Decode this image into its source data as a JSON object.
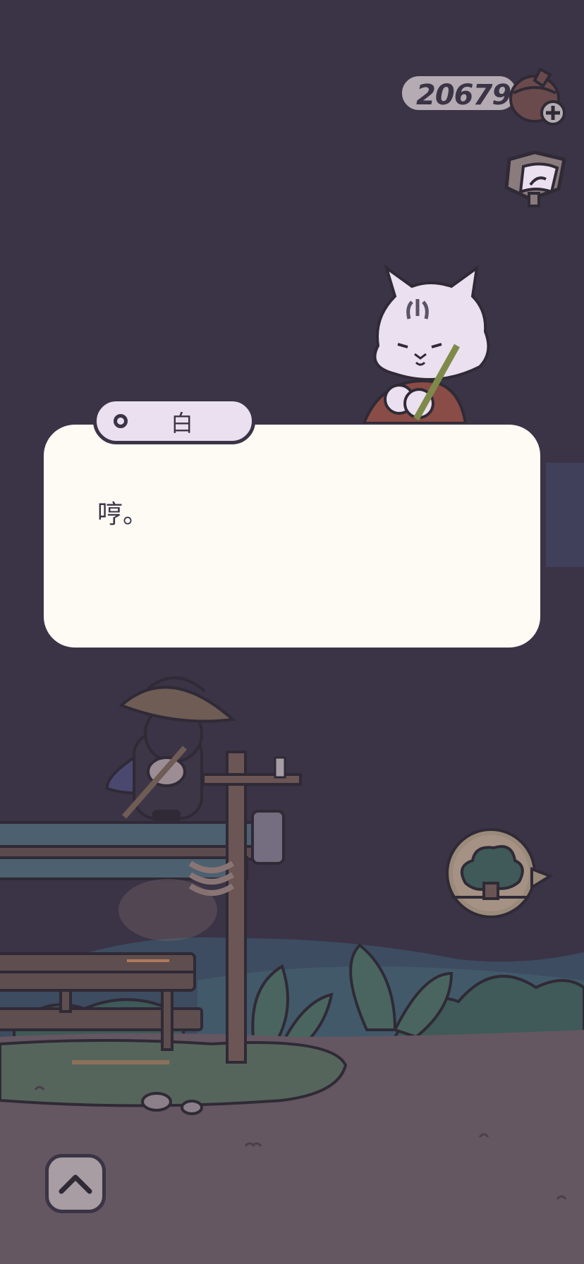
{
  "currency": {
    "amount": "20679",
    "icon": "acorn-icon",
    "add_icon": "plus-icon"
  },
  "journal": {
    "icon": "journal-icon"
  },
  "dialogue": {
    "speaker": "白",
    "text": "哼。"
  },
  "destination": {
    "icon": "tree-icon"
  },
  "controls": {
    "expand_icon": "chevron-up-icon"
  },
  "colors": {
    "sky": "#3b3446",
    "ground": "#645762",
    "dialog_bg": "#fefbf5",
    "name_tab_bg": "#ebe0ef",
    "outline": "#3b3446"
  }
}
